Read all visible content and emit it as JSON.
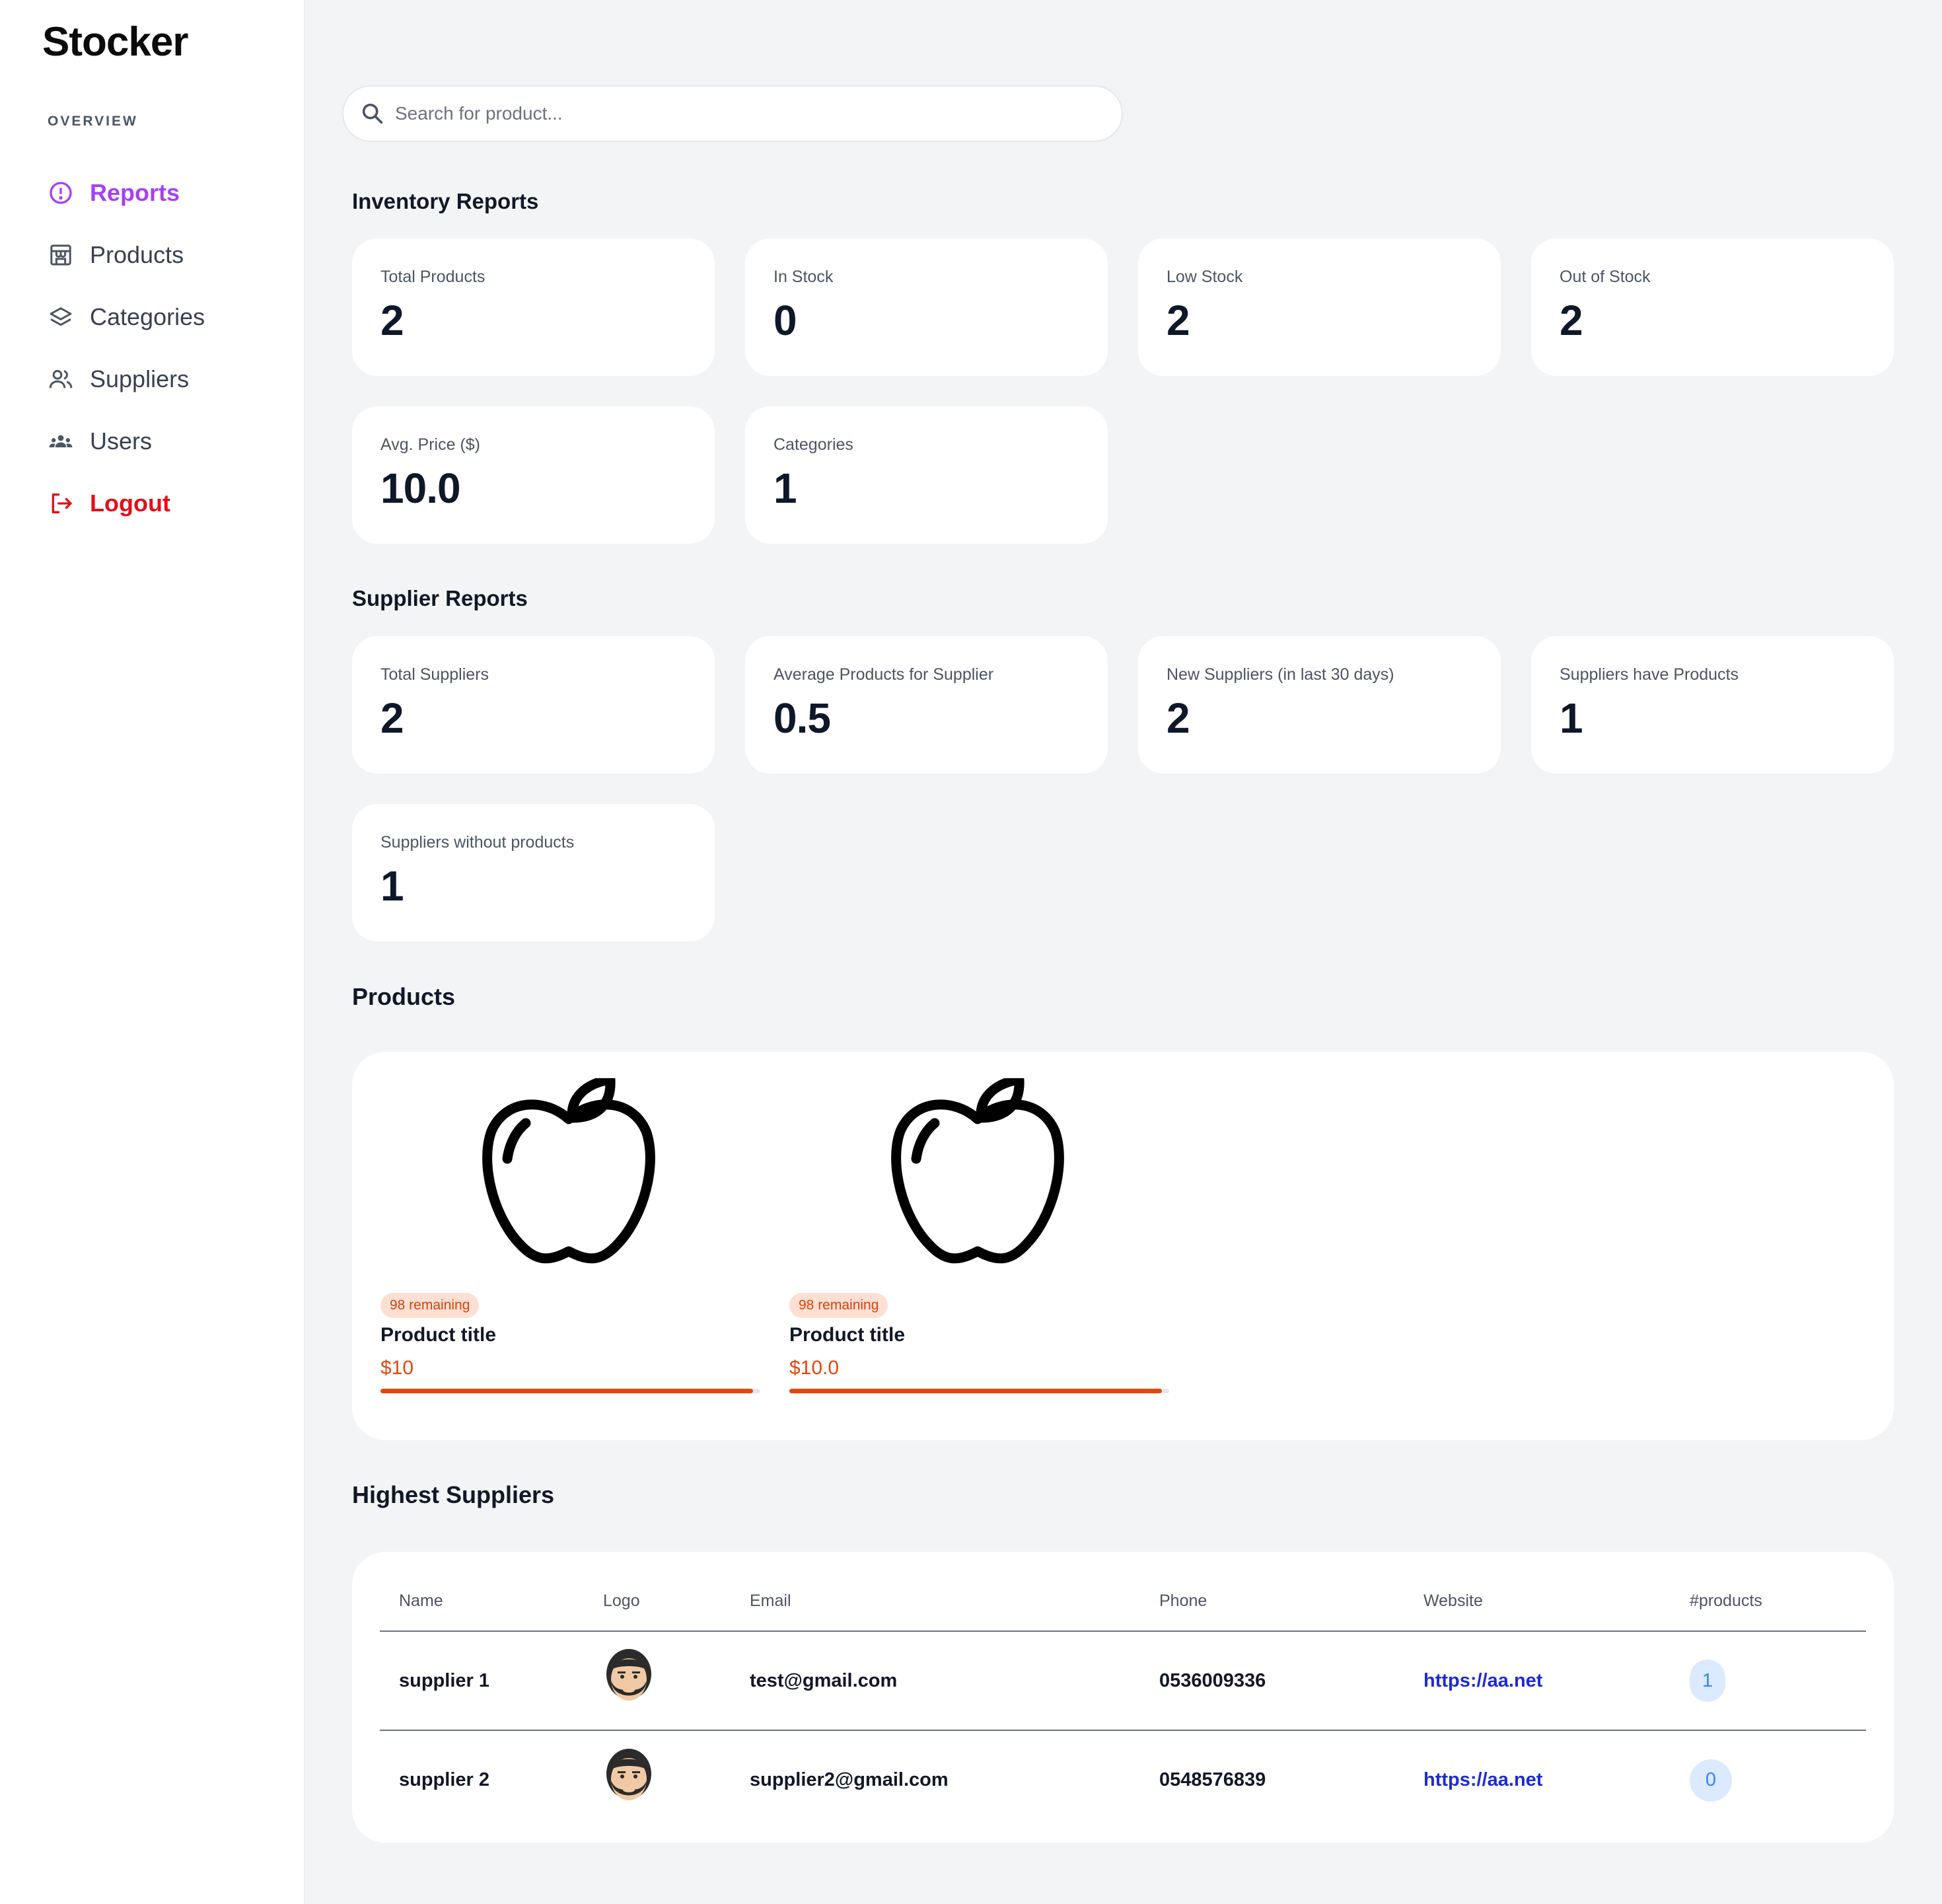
{
  "app": {
    "name": "Stocker"
  },
  "sidebar": {
    "heading": "OVERVIEW",
    "items": [
      {
        "label": "Reports",
        "icon": "alert-circle-icon",
        "active": true
      },
      {
        "label": "Products",
        "icon": "store-icon"
      },
      {
        "label": "Categories",
        "icon": "layers-icon"
      },
      {
        "label": "Suppliers",
        "icon": "user-group-icon"
      },
      {
        "label": "Users",
        "icon": "users-icon"
      },
      {
        "label": "Logout",
        "icon": "logout-icon"
      }
    ]
  },
  "search": {
    "placeholder": "Search for product..."
  },
  "inventory": {
    "title": "Inventory Reports",
    "cards": [
      {
        "label": "Total Products",
        "value": "2"
      },
      {
        "label": "In Stock",
        "value": "0"
      },
      {
        "label": "Low Stock",
        "value": "2"
      },
      {
        "label": "Out of Stock",
        "value": "2"
      },
      {
        "label": "Avg. Price ($)",
        "value": "10.0"
      },
      {
        "label": "Categories",
        "value": "1"
      }
    ]
  },
  "supplier_reports": {
    "title": "Supplier Reports",
    "cards": [
      {
        "label": "Total Suppliers",
        "value": "2"
      },
      {
        "label": "Average Products for Supplier",
        "value": "0.5"
      },
      {
        "label": "New Suppliers (in last 30 days)",
        "value": "2"
      },
      {
        "label": "Suppliers have Products",
        "value": "1"
      },
      {
        "label": "Suppliers without products",
        "value": "1"
      }
    ]
  },
  "products": {
    "title": "Products",
    "items": [
      {
        "badge": "98 remaining",
        "title": "Product title",
        "price": "$10",
        "icon": "apple-icon",
        "stock_fraction": 0.98
      },
      {
        "badge": "98 remaining",
        "title": "Product title",
        "price": "$10.0",
        "icon": "apple-icon",
        "stock_fraction": 0.98
      }
    ]
  },
  "highest_suppliers": {
    "title": "Highest Suppliers",
    "columns": [
      "Name",
      "Logo",
      "Email",
      "Phone",
      "Website",
      "#products"
    ],
    "rows": [
      {
        "name": "supplier 1",
        "logo": "bearded-man-avatar-icon",
        "email": "test@gmail.com",
        "phone": "0536009336",
        "website": "https://aa.net",
        "products": "1"
      },
      {
        "name": "supplier 2",
        "logo": "bearded-man-avatar-icon",
        "email": "supplier2@gmail.com",
        "phone": "0548576839",
        "website": "https://aa.net",
        "products": "0"
      }
    ]
  },
  "colors": {
    "accent": "#a63ff5",
    "logout": "#e0101a",
    "price": "#e0480e",
    "link": "#1d2bd8",
    "background": "#f3f4f6"
  }
}
